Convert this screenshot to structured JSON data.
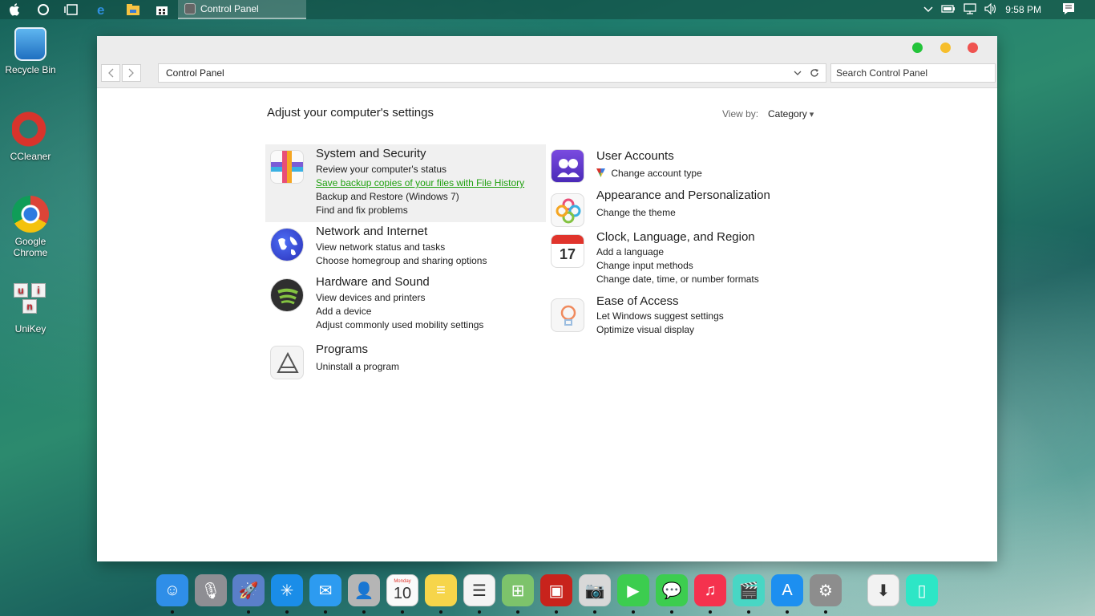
{
  "taskbar": {
    "active_app": "Control Panel",
    "clock": "9:58 PM",
    "icons": [
      "apple-icon",
      "cortana-icon",
      "task-view-icon",
      "edge-icon",
      "file-explorer-icon",
      "store-icon"
    ],
    "tray_icons": [
      "chevron-up-icon",
      "battery-icon",
      "network-icon",
      "volume-icon",
      "notification-icon"
    ]
  },
  "desktop": {
    "icons": [
      {
        "label": "Recycle Bin",
        "icon": "recycle-bin-icon",
        "color": "#3a8fd6"
      },
      {
        "label": "CCleaner",
        "icon": "ccleaner-icon",
        "color": "#d8342c"
      },
      {
        "label": "Google Chrome",
        "icon": "chrome-icon",
        "color": "#2d7be0"
      },
      {
        "label": "UniKey",
        "icon": "unikey-icon",
        "color": "#f3f3f3"
      }
    ]
  },
  "window": {
    "address": "Control Panel",
    "search_placeholder": "Search Control Panel",
    "heading": "Adjust your computer's settings",
    "view_by_label": "View by:",
    "view_by_value": "Category",
    "categories_left": [
      {
        "title": "System and Security",
        "icon": "system-security-icon",
        "highlighted": true,
        "links": [
          "Review your computer's status",
          "Save backup copies of your files with File History",
          "Backup and Restore (Windows 7)",
          "Find and fix problems"
        ]
      },
      {
        "title": "Network and Internet",
        "icon": "network-internet-icon",
        "links": [
          "View network status and tasks",
          "Choose homegroup and sharing options"
        ]
      },
      {
        "title": "Hardware and Sound",
        "icon": "hardware-sound-icon",
        "links": [
          "View devices and printers",
          "Add a device",
          "Adjust commonly used mobility settings"
        ]
      },
      {
        "title": "Programs",
        "icon": "programs-icon",
        "links": [
          "Uninstall a program"
        ]
      }
    ],
    "categories_right": [
      {
        "title": "User Accounts",
        "icon": "user-accounts-icon",
        "links": [
          "Change account type"
        ]
      },
      {
        "title": "Appearance and Personalization",
        "icon": "appearance-icon",
        "links": [
          "Change the theme"
        ]
      },
      {
        "title": "Clock, Language, and Region",
        "icon": "calendar-icon",
        "icon_text": "17",
        "links": [
          "Add a language",
          "Change input methods",
          "Change date, time, or number formats"
        ]
      },
      {
        "title": "Ease of Access",
        "icon": "ease-of-access-icon",
        "links": [
          "Let Windows suggest settings",
          "Optimize visual display"
        ]
      }
    ]
  },
  "dock": {
    "items": [
      {
        "name": "finder-icon",
        "color": "#2f8ee8",
        "glyph": "☺"
      },
      {
        "name": "siri-icon",
        "color": "#8e8e93",
        "glyph": "🎙"
      },
      {
        "name": "launchpad-icon",
        "color": "#5a7fc9",
        "glyph": "🚀"
      },
      {
        "name": "safari-icon",
        "color": "#1a8de8",
        "glyph": "✳"
      },
      {
        "name": "mail-icon",
        "color": "#2d9bf0",
        "glyph": "✉"
      },
      {
        "name": "contacts-icon",
        "color": "#b5b5b5",
        "glyph": "👤"
      },
      {
        "name": "calendar-dock-icon",
        "color": "#fafafa",
        "glyph": "10",
        "month": "Monday"
      },
      {
        "name": "notes-icon",
        "color": "#f6d54a",
        "glyph": "≡"
      },
      {
        "name": "reminders-icon",
        "color": "#f4f4f4",
        "glyph": "☰"
      },
      {
        "name": "maps-icon",
        "color": "#7dc36b",
        "glyph": "⊞"
      },
      {
        "name": "photo-booth-icon",
        "color": "#c8231c",
        "glyph": "▣"
      },
      {
        "name": "camera-icon",
        "color": "#d8d8d8",
        "glyph": "📷"
      },
      {
        "name": "facetime-icon",
        "color": "#3ccd4f",
        "glyph": "▶"
      },
      {
        "name": "messages-icon",
        "color": "#3ccd4f",
        "glyph": "💬"
      },
      {
        "name": "music-icon",
        "color": "#f5324e",
        "glyph": "♫"
      },
      {
        "name": "imovie-icon",
        "color": "#48d6c4",
        "glyph": "🎬"
      },
      {
        "name": "app-store-icon",
        "color": "#1d8ff0",
        "glyph": "A"
      },
      {
        "name": "system-preferences-icon",
        "color": "#8d8d8d",
        "glyph": "⚙"
      },
      {
        "name": "downloads-icon",
        "color": "#f2f2f2",
        "glyph": "⬇"
      },
      {
        "name": "document-icon",
        "color": "#2de6c6",
        "glyph": "▯"
      }
    ]
  }
}
